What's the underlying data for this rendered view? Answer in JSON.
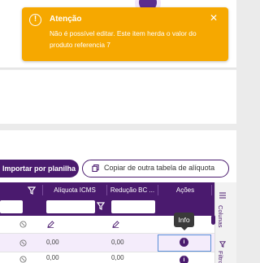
{
  "toast": {
    "title": "Atenção",
    "message": "Não é possível editar. Este item herda o valor do produto referencia 7",
    "icon": "alert-circle-icon",
    "close_icon": "close-icon",
    "color": "#f6a800"
  },
  "toolbar": {
    "import_label": "Importar por planilha",
    "copy_label": "Copiar de outra tabela de alíquota",
    "copy_icon": "copy-icon"
  },
  "table": {
    "headers": [
      "Alíquota ICMS",
      "Redução BC ...",
      "Ações"
    ],
    "rows": [
      {
        "icms": "",
        "reducao": "",
        "info": ""
      },
      {
        "icms": "0,00",
        "reducao": "0,00",
        "info": "i"
      },
      {
        "icms": "0,00",
        "reducao": "0,00",
        "info": "i"
      }
    ]
  },
  "tooltip": {
    "text": "Info"
  },
  "side_tabs": {
    "columns": "Colunas",
    "filters": "Filtro"
  },
  "colors": {
    "primary": "#4a1a6e",
    "warning": "#f6a800",
    "selected_row": "#f4ecfb",
    "focus": "#5a8fd8"
  }
}
